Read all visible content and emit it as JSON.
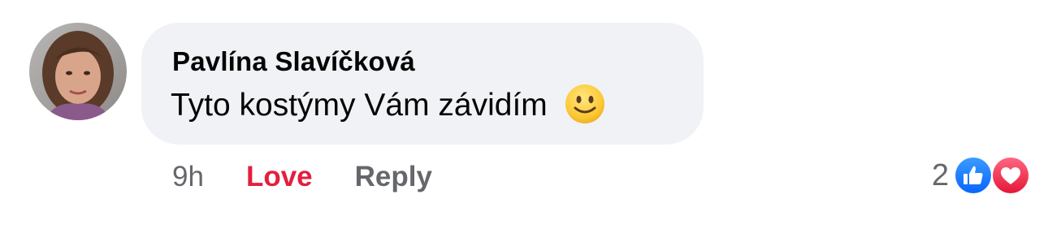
{
  "comment": {
    "author": "Pavlína Slavíčková",
    "text": "Tyto kostýmy Vám závidím",
    "emoji": "slightly-smiling-face-icon"
  },
  "actions": {
    "time": "9h",
    "love_label": "Love",
    "reply_label": "Reply"
  },
  "reactions": {
    "count": "2",
    "types": [
      "like",
      "love"
    ]
  },
  "colors": {
    "bubble": "#f0f2f5",
    "love_active": "#e41e3f",
    "secondary_text": "#65676b",
    "like_blue": "#1877f2",
    "love_red": "#f33e58"
  }
}
